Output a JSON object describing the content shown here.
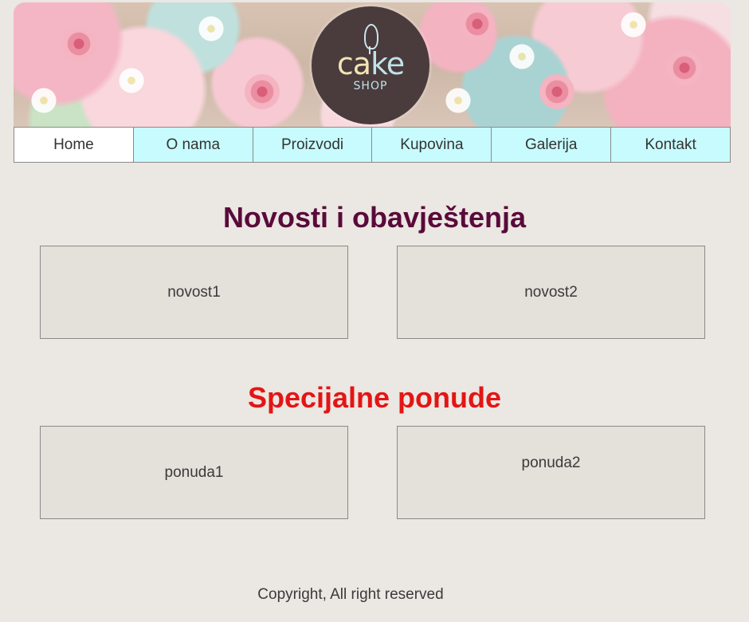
{
  "header": {
    "logo_word_part1": "ca",
    "logo_word_part2": "ke",
    "logo_sub": "SHOP"
  },
  "nav": {
    "items": [
      {
        "label": "Home",
        "active": true
      },
      {
        "label": "O nama",
        "active": false
      },
      {
        "label": "Proizvodi",
        "active": false
      },
      {
        "label": "Kupovina",
        "active": false
      },
      {
        "label": "Galerija",
        "active": false
      },
      {
        "label": "Kontakt",
        "active": false
      }
    ]
  },
  "news": {
    "title": "Novosti i obavještenja",
    "items": [
      "novost1",
      "novost2"
    ]
  },
  "offers": {
    "title": "Specijalne ponude",
    "items": [
      "ponuda1",
      "ponuda2"
    ]
  },
  "footer": {
    "text": "Copyright, All right reserved"
  },
  "colors": {
    "background": "#ebe7e2",
    "nav_bg": "#c8fbfd",
    "news_title": "#5a0a3a",
    "offers_title": "#e31515",
    "card_bg": "#e4e0da"
  }
}
